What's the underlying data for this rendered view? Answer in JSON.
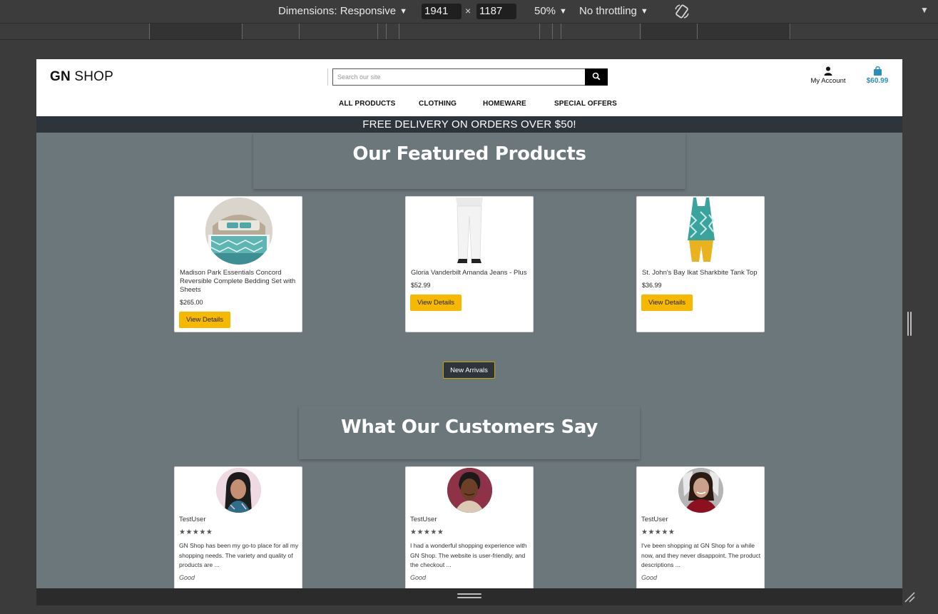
{
  "devtools": {
    "dimensions_label": "Dimensions: Responsive",
    "width": "1941",
    "times": "×",
    "height": "1187",
    "zoom": "50%",
    "throttling": "No throttling",
    "rotate_icon": "rotate-icon",
    "more_icon": "more-options-icon"
  },
  "header": {
    "logo_bold": "GN",
    "logo_rest": "SHOP",
    "search_placeholder": "Search our site",
    "account_label": "My Account",
    "cart_total": "$60.99",
    "brand_color": "#2a8fb8"
  },
  "nav": {
    "items": [
      "ALL PRODUCTS",
      "CLOTHING",
      "HOMEWARE",
      "SPECIAL OFFERS"
    ]
  },
  "promo": {
    "text": "FREE DELIVERY ON ORDERS OVER $50!"
  },
  "featured": {
    "title": "Our Featured Products",
    "products": [
      {
        "name": "Madison Park Essentials Concord Reversible Complete Bedding Set with Sheets",
        "price": "$265.00",
        "button": "View Details"
      },
      {
        "name": "Gloria Vanderbilt Amanda Jeans - Plus",
        "price": "$52.99",
        "button": "View Details"
      },
      {
        "name": "St. John's Bay Ikat Sharkbite Tank Top",
        "price": "$36.99",
        "button": "View Details"
      }
    ],
    "new_arrivals": "New Arrivals"
  },
  "testimonials": {
    "title": "What Our Customers Say",
    "reviews": [
      {
        "user": "TestUser",
        "stars": "★★★★★",
        "text": "GN Shop has been my go-to place for all my shopping needs. The variety and quality of products are ...",
        "rating": "Good"
      },
      {
        "user": "TestUser",
        "stars": "★★★★★",
        "text": "I had a wonderful shopping experience with GN Shop. The website is user-friendly, and the checkout ...",
        "rating": "Good"
      },
      {
        "user": "TestUser",
        "stars": "★★★★★",
        "text": "I've been shopping at GN Shop for a while now, and they never disappoint. The product descriptions ...",
        "rating": "Good"
      }
    ]
  },
  "colors": {
    "page_bg": "#6c777c",
    "promo_bg": "#2e343b",
    "button_yellow": "#f6b800"
  }
}
